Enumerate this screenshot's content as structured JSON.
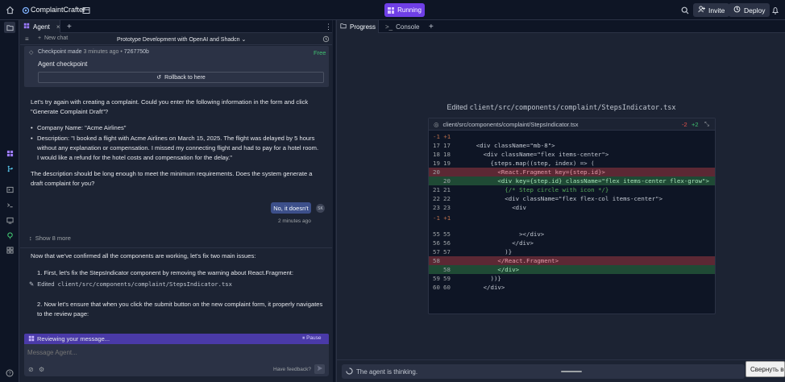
{
  "topbar": {
    "app_name": "ComplaintCrafter",
    "running_label": "Running",
    "invite_label": "Invite",
    "deploy_label": "Deploy"
  },
  "agent": {
    "tab_label": "Agent",
    "new_chat_label": "New chat",
    "chat_title": "Prototype Development with OpenAI and Shadcn",
    "checkpoint": {
      "made_label": "Checkpoint made",
      "time": "3 minutes ago",
      "hash": "7267750b",
      "free_label": "Free",
      "title": "Agent checkpoint",
      "rollback_label": "Rollback to here"
    },
    "msg1": {
      "intro": "Let's try again with creating a complaint. Could you enter the following information in the form and click \"Generate Complaint Draft\"?",
      "bullet_company": "Company Name: \"Acme Airlines\"",
      "bullet_desc": "Description: \"I booked a flight with Acme Airlines on March 15, 2025. The flight was delayed by 5 hours without any explanation or compensation. I missed my connecting flight and had to pay for a hotel room. I would like a refund for the hotel costs and compensation for the delay.\"",
      "outro": "The description should be long enough to meet the minimum requirements. Does the system generate a draft complaint for you?"
    },
    "user_reply": "No, it doesn't",
    "user_initials": "SK",
    "reply_time": "2 minutes ago",
    "show_more": "Show 8 more",
    "msg2": {
      "intro": "Now that we've confirmed all the components are working, let's fix two main issues:",
      "step1": "1. First, let's fix the StepsIndicator component by removing the warning about React.Fragment:",
      "edited_prefix": "Edited",
      "edited_file": "client/src/components/complaint/StepsIndicator.tsx",
      "step2": "2. Now let's ensure that when you click the submit button on the new complaint form, it properly navigates to the review page:"
    },
    "reviewing_label": "Reviewing your message...",
    "pause_label": "Pause",
    "input_placeholder": "Message Agent...",
    "feedback_label": "Have feedback?"
  },
  "right": {
    "tab_progress": "Progress",
    "tab_console": "Console",
    "edited_label": "Edited",
    "edited_file": "client/src/components/complaint/StepsIndicator.tsx",
    "diff_file": "client/src/components/complaint/StepsIndicator.tsx",
    "diff_minus": "-2",
    "diff_plus": "+2",
    "thinking_label": "The agent is thinking.",
    "tooltip": "Свернуть во"
  },
  "diff_lines": [
    {
      "type": "hunk",
      "n1": "",
      "n2": "",
      "code": "-1 +1"
    },
    {
      "type": "ctx",
      "n1": "17",
      "n2": "17",
      "code": "      <div className=\"mb-8\">"
    },
    {
      "type": "ctx",
      "n1": "18",
      "n2": "18",
      "code": "        <div className=\"flex items-center\">"
    },
    {
      "type": "ctx",
      "n1": "19",
      "n2": "19",
      "code": "          {steps.map((step, index) => ("
    },
    {
      "type": "del",
      "n1": "20",
      "n2": "",
      "code": "            <React.Fragment key={step.id}>"
    },
    {
      "type": "add",
      "n1": "",
      "n2": "20",
      "code": "            <div key={step.id} className=\"flex items-center flex-grow\">"
    },
    {
      "type": "ctx",
      "n1": "21",
      "n2": "21",
      "code": "              {/* Step circle with icon */}"
    },
    {
      "type": "ctx",
      "n1": "22",
      "n2": "22",
      "code": "              <div className=\"flex flex-col items-center\">"
    },
    {
      "type": "ctx",
      "n1": "23",
      "n2": "23",
      "code": "                <div"
    },
    {
      "type": "hunk",
      "n1": "",
      "n2": "",
      "code": "-1 +1"
    },
    {
      "type": "blank",
      "n1": "",
      "n2": "",
      "code": ""
    },
    {
      "type": "ctx",
      "n1": "55",
      "n2": "55",
      "code": "                  ></div>"
    },
    {
      "type": "ctx",
      "n1": "56",
      "n2": "56",
      "code": "                </div>"
    },
    {
      "type": "ctx",
      "n1": "57",
      "n2": "57",
      "code": "              )}"
    },
    {
      "type": "del",
      "n1": "58",
      "n2": "",
      "code": "            </React.Fragment>"
    },
    {
      "type": "add",
      "n1": "",
      "n2": "58",
      "code": "            </div>"
    },
    {
      "type": "ctx",
      "n1": "59",
      "n2": "59",
      "code": "          ))}"
    },
    {
      "type": "ctx",
      "n1": "60",
      "n2": "60",
      "code": "        </div>"
    }
  ]
}
